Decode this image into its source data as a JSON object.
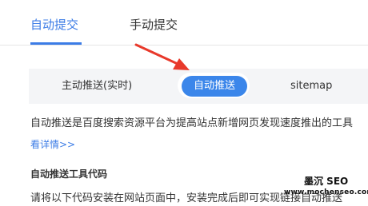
{
  "tabs": {
    "auto": "自动提交",
    "manual": "手动提交"
  },
  "subnav": {
    "active_push": "主动推送(实时)",
    "auto_push": "自动推送",
    "sitemap": "sitemap"
  },
  "content": {
    "description": "自动推送是百度搜索资源平台为提高站点新增网页发现速度推出的工具",
    "details_link": "看详情>>",
    "code_heading": "自动推送工具代码",
    "install_text": "请将以下代码安装在网站页面中，安装完成后即可实现链接自动推送"
  },
  "watermark": {
    "name": "墨沉 SEO",
    "url": "www.mochenseo.com"
  },
  "colors": {
    "accent": "#3c7ce6",
    "pill": "#3b86ea",
    "arrow": "#e8392b"
  }
}
